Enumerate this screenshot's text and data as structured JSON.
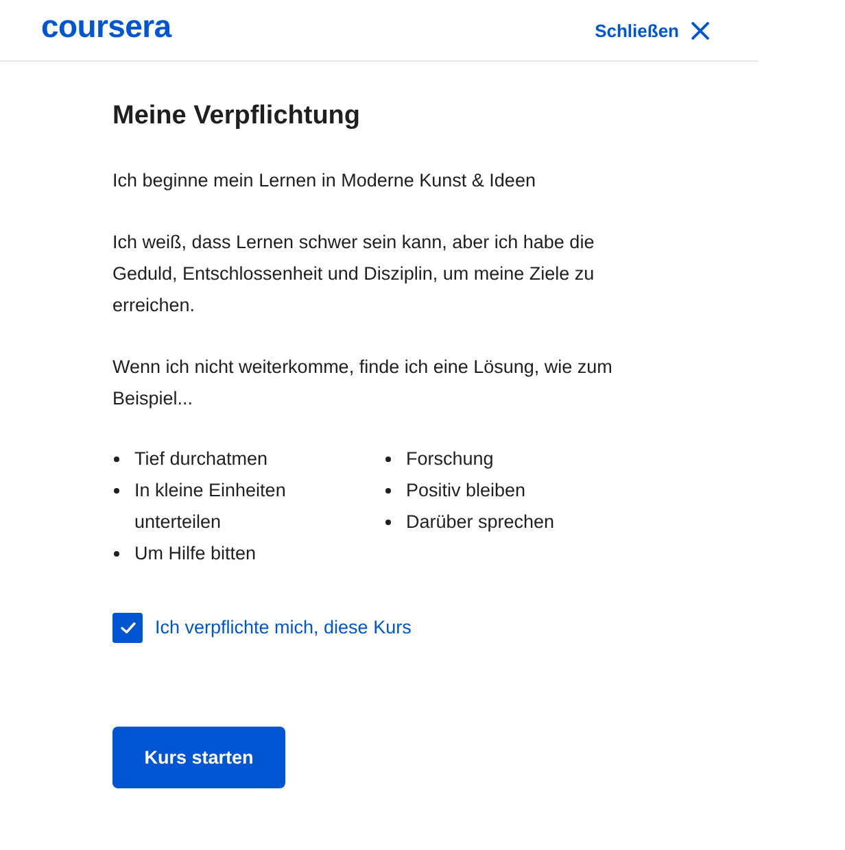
{
  "header": {
    "logo": "coursera",
    "close_label": "Schließen"
  },
  "title": "Meine Verpflichtung",
  "paragraphs": [
    "Ich beginne mein Lernen in Moderne Kunst & Ideen",
    "Ich weiß, dass Lernen schwer sein kann, aber ich habe die Geduld, Entschlossenheit und Disziplin, um meine Ziele zu erreichen.",
    "Wenn ich nicht weiterkomme, finde ich eine Lösung, wie zum Beispiel..."
  ],
  "strategy_columns": [
    [
      "Tief durchatmen",
      "In kleine Einheiten unterteilen",
      "Um Hilfe bitten"
    ],
    [
      "Forschung",
      "Positiv bleiben",
      "Darüber sprechen"
    ]
  ],
  "commitment": {
    "label": "Ich verpflichte mich, diese Kurs",
    "checked": true
  },
  "start_button": "Kurs starten"
}
